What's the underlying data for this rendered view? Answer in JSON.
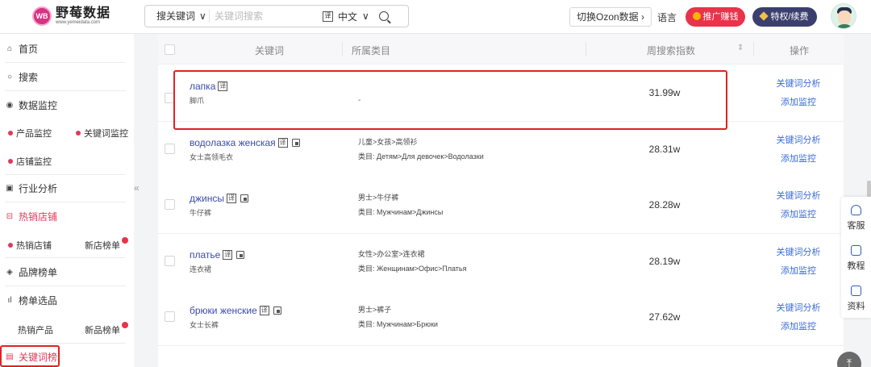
{
  "header": {
    "logo_badge": "WB",
    "logo_name": "野莓数据",
    "logo_url": "www.yemeidata.com",
    "search_type": "搜关键词",
    "search_placeholder": "关键词搜索",
    "translate_icon": "译",
    "language_select": "中文",
    "ozon_switch": "切换Ozon数据",
    "language_link": "语言",
    "promo_button": "推广赚钱",
    "vip_button": "特权/续费",
    "avatar_alt": "user-avatar"
  },
  "sidebar": {
    "items": [
      {
        "label": "首页",
        "icon": "home-icon"
      },
      {
        "label": "搜索",
        "icon": "search-icon"
      },
      {
        "label": "数据监控",
        "icon": "eye-icon"
      },
      {
        "label": "行业分析",
        "icon": "chart-icon"
      },
      {
        "label": "热销店铺",
        "icon": "shop-icon"
      },
      {
        "label": "品牌榜单",
        "icon": "brand-icon"
      },
      {
        "label": "榜单选品",
        "icon": "bar-chart-icon"
      },
      {
        "label": "关键词榜",
        "icon": "document-icon"
      }
    ],
    "sub": {
      "product_monitor": "产品监控",
      "keyword_monitor": "关键词监控",
      "shop_monitor": "店铺监控",
      "hot_shops": "热销店铺",
      "new_shops": "新店榜单",
      "hot_products": "热销产品",
      "new_products": "新品榜单"
    },
    "collapse_glyph": "«"
  },
  "table": {
    "columns": {
      "keyword": "关键词",
      "category": "所属类目",
      "weekly_search": "周搜索指数",
      "action": "操作"
    },
    "actions": {
      "analyze": "关键词分析",
      "monitor": "添加监控"
    },
    "category_prefix": "类目:",
    "rows": [
      {
        "keyword": "лапка",
        "translation": "脚爪",
        "cat_cn": "",
        "cat_ru": "-",
        "volume": "31.99w"
      },
      {
        "keyword": "водолазка женская",
        "translation": "女士高领毛衣",
        "cat_cn": "儿童>女孩>高领衫",
        "cat_ru": "Детям>Для девочек>Водолазки",
        "volume": "28.31w"
      },
      {
        "keyword": "джинсы",
        "translation": "牛仔裤",
        "cat_cn": "男士>牛仔裤",
        "cat_ru": "Мужчинам>Джинсы",
        "volume": "28.28w"
      },
      {
        "keyword": "платье",
        "translation": "连衣裙",
        "cat_cn": "女性>办公室>连衣裙",
        "cat_ru": "Женщинам>Офис>Платья",
        "volume": "28.19w"
      },
      {
        "keyword": "брюки женские",
        "translation": "女士长裤",
        "cat_cn": "男士>裤子",
        "cat_ru": "Мужчинам>Брюки",
        "volume": "27.62w"
      }
    ]
  },
  "float_panel": {
    "service": "客服",
    "tutorial": "教程",
    "materials": "资料"
  },
  "colors": {
    "accent": "#3a6bd8",
    "highlight": "#e12121",
    "hot": "#e0395a"
  }
}
